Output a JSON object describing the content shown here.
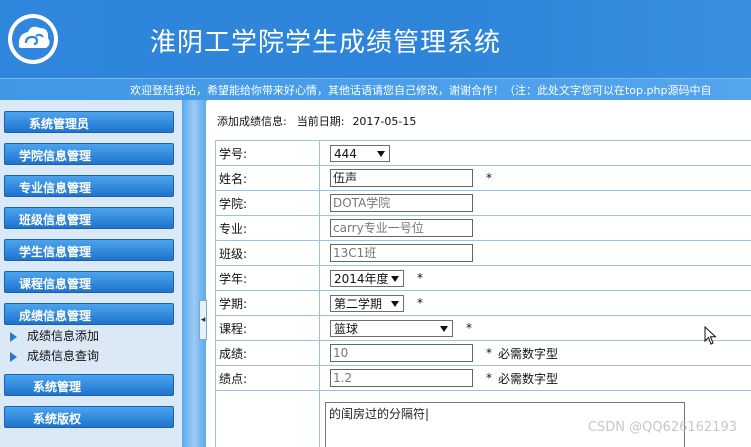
{
  "header": {
    "title": "淮阴工学院学生成绩管理系统",
    "logo_icon": "cloud-swirl-logo-icon",
    "marquee": "欢迎登陆我站，希望能给你带来好心情，其他话语请您自己修改，谢谢合作！（注：此处文字您可以在top.php源码中自"
  },
  "sidebar": {
    "sections": [
      {
        "label": "系统管理员"
      },
      {
        "label": "学院信息管理"
      },
      {
        "label": "专业信息管理"
      },
      {
        "label": "班级信息管理"
      },
      {
        "label": "学生信息管理"
      },
      {
        "label": "课程信息管理"
      },
      {
        "label": "成绩信息管理"
      }
    ],
    "sub_items": [
      {
        "label": "成绩信息添加"
      },
      {
        "label": "成绩信息查询"
      }
    ],
    "bottom_sections": [
      {
        "label": "系统管理"
      },
      {
        "label": "系统版权"
      }
    ]
  },
  "splitter": {
    "handle_glyph": "◂"
  },
  "main": {
    "heading": "添加成绩信息:",
    "date_label": "当前日期:",
    "date_value": "2017-05-15",
    "fields": {
      "student_id": {
        "label": "学号:",
        "value": "444"
      },
      "name": {
        "label": "姓名:",
        "value": "伍声",
        "required": "*"
      },
      "college": {
        "label": "学院:",
        "value": "DOTA学院"
      },
      "major": {
        "label": "专业:",
        "value": "carry专业一号位"
      },
      "class": {
        "label": "班级:",
        "value": "13C1班"
      },
      "year": {
        "label": "学年:",
        "value": "2014年度",
        "required": "*"
      },
      "term": {
        "label": "学期:",
        "value": "第二学期",
        "required": "*"
      },
      "course": {
        "label": "课程:",
        "value": "篮球",
        "required": "*"
      },
      "score": {
        "label": "成绩:",
        "value": "10",
        "required": "*",
        "hint": "必需数字型"
      },
      "gpa": {
        "label": "绩点:",
        "value": "1.2",
        "required": "*",
        "hint": "必需数字型"
      },
      "remark": {
        "value": "的闺房过的分隔符|"
      }
    }
  },
  "watermark": "CSDN @QQ626162193",
  "colors": {
    "header_blue": "#2f86dc",
    "nav_button_blue": "#1f73cc",
    "sidebar_bg": "#dbe9f7",
    "table_border": "#9dc1e4"
  }
}
